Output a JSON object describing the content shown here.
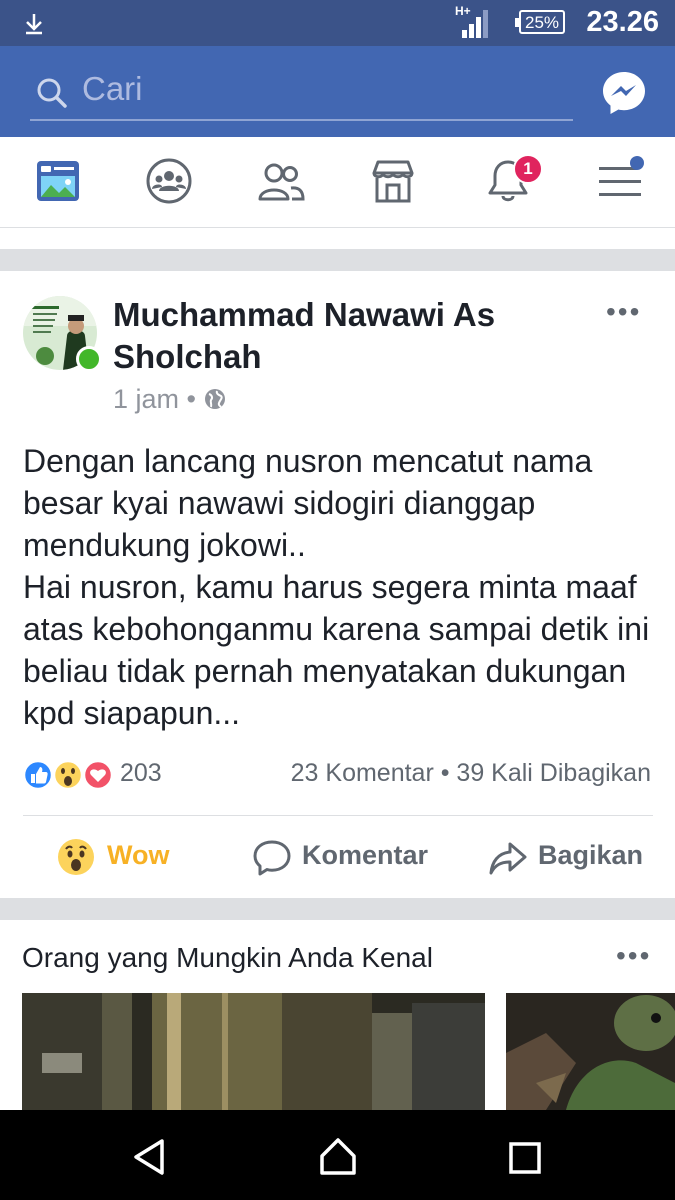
{
  "status_bar": {
    "time": "23.26",
    "battery": "25%",
    "network": "H+"
  },
  "search": {
    "placeholder": "Cari"
  },
  "nav": {
    "notification_count": "1",
    "tabs": [
      "news-feed",
      "groups",
      "friends",
      "marketplace",
      "notifications",
      "menu"
    ]
  },
  "post": {
    "author": "Muchammad Nawawi As Sholchah",
    "time": "1 jam",
    "separator": "•",
    "more": "•••",
    "text": "Dengan lancang nusron mencatut nama besar kyai nawawi sidogiri dianggap mendukung jokowi..\nHai nusron, kamu harus segera minta maaf atas kebohonganmu karena sampai detik ini beliau tidak pernah menyatakan dukungan kpd siapapun...",
    "reaction_count": "203",
    "engagement": "23 Komentar • 39 Kali Dibagikan",
    "actions": {
      "wow": "Wow",
      "comment": "Komentar",
      "share": "Bagikan"
    }
  },
  "suggestions": {
    "title": "Orang yang Mungkin Anda Kenal",
    "more": "•••"
  },
  "colors": {
    "status_bar": "#3b5389",
    "header": "#4267b2",
    "wow": "#f7b125",
    "online": "#42b72a",
    "badge": "#e0245e"
  }
}
